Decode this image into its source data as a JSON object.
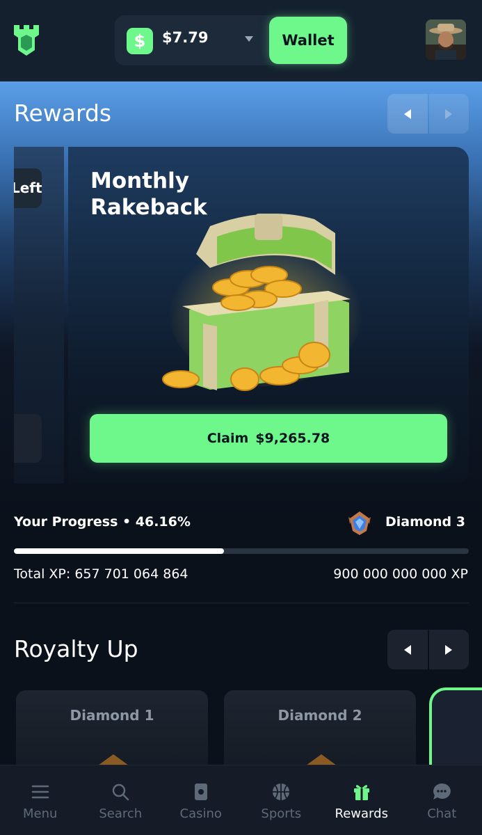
{
  "header": {
    "balance": "$7.79",
    "currency_symbol": "$",
    "wallet_label": "Wallet"
  },
  "rewards": {
    "title": "Rewards",
    "prev_card_text": "Left",
    "card": {
      "title": "Monthly Rakeback",
      "claim_label": "Claim",
      "claim_amount": "$9,265.78"
    }
  },
  "progress": {
    "label": "Your Progress • 46.16%",
    "percent": 46.16,
    "tier": "Diamond 3",
    "total_xp": "Total XP: 657 701 064 864",
    "target_xp": "900 000 000 000 XP"
  },
  "royalty": {
    "title": "Royalty Up",
    "tiers": [
      "Diamond 1",
      "Diamond 2"
    ]
  },
  "bottom_nav": [
    {
      "label": "Menu",
      "icon": "menu-icon"
    },
    {
      "label": "Search",
      "icon": "search-icon"
    },
    {
      "label": "Casino",
      "icon": "casino-icon"
    },
    {
      "label": "Sports",
      "icon": "basketball-icon"
    },
    {
      "label": "Rewards",
      "icon": "gift-icon",
      "active": true
    },
    {
      "label": "Chat",
      "icon": "chat-icon"
    }
  ],
  "colors": {
    "accent": "#6ef78b",
    "background": "#0b111b",
    "header": "#14202e",
    "inactive_nav": "#5f6a78"
  }
}
